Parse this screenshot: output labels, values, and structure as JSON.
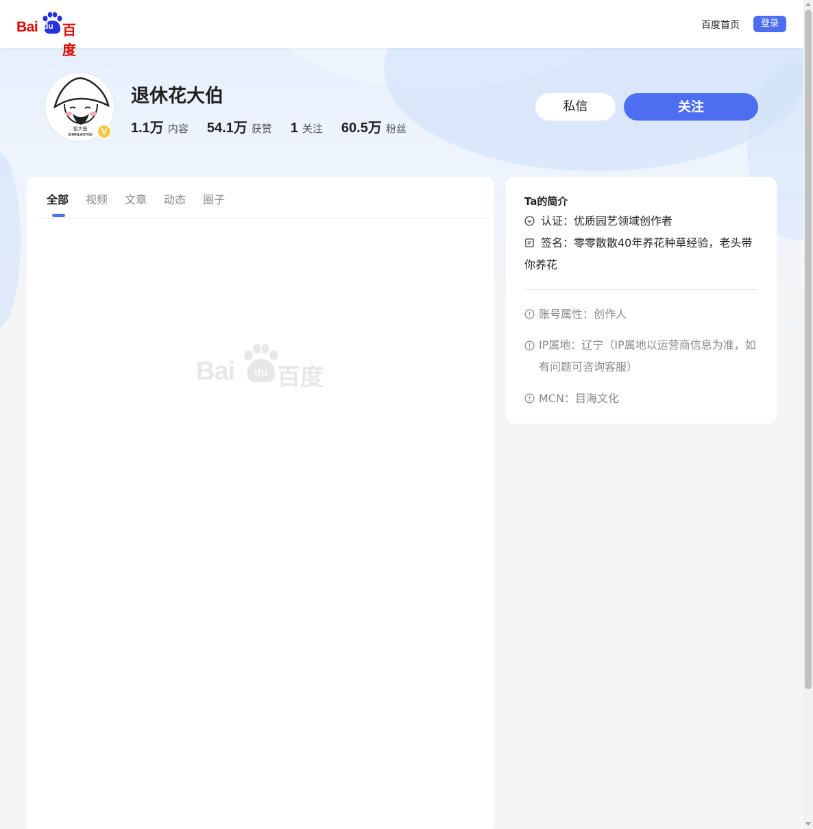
{
  "colors": {
    "accent": "#4e6ef2",
    "brand_red": "#e10602",
    "badge_gold": "#f5c84a"
  },
  "nav": {
    "logo_latin": "Bai",
    "logo_du": "du",
    "logo_chinese": "百度",
    "home_link": "百度首页",
    "login_button": "登录"
  },
  "profile": {
    "name": "退休花大伯",
    "verified_badge": "V",
    "avatar_text_top": "花大伯",
    "avatar_text_bottom": "SHANLAOTOU",
    "stats": [
      {
        "value": "1.1万",
        "label": "内容"
      },
      {
        "value": "54.1万",
        "label": "获赞"
      },
      {
        "value": "1",
        "label": "关注"
      },
      {
        "value": "60.5万",
        "label": "粉丝"
      }
    ],
    "message_button": "私信",
    "follow_button": "关注"
  },
  "main": {
    "tabs": [
      {
        "label": "全部",
        "active": true
      },
      {
        "label": "视频",
        "active": false
      },
      {
        "label": "文章",
        "active": false
      },
      {
        "label": "动态",
        "active": false
      },
      {
        "label": "圈子",
        "active": false
      }
    ],
    "watermark_latin": "Bai",
    "watermark_du": "du",
    "watermark_chinese": "百度"
  },
  "sidebar": {
    "title": "Ta的简介",
    "certification": "认证：优质园艺领域创作者",
    "signature": "签名：零零散散40年养花种草经验，老头带你养花",
    "account_type": "账号属性：创作人",
    "ip_location": "IP属地：辽宁（IP属地以运营商信息为准，如有问题可咨询客服）",
    "mcn": "MCN：目海文化"
  },
  "icons": {
    "verify": "check-circle-icon",
    "signature": "note-icon",
    "info": "exclamation-circle-icon"
  }
}
